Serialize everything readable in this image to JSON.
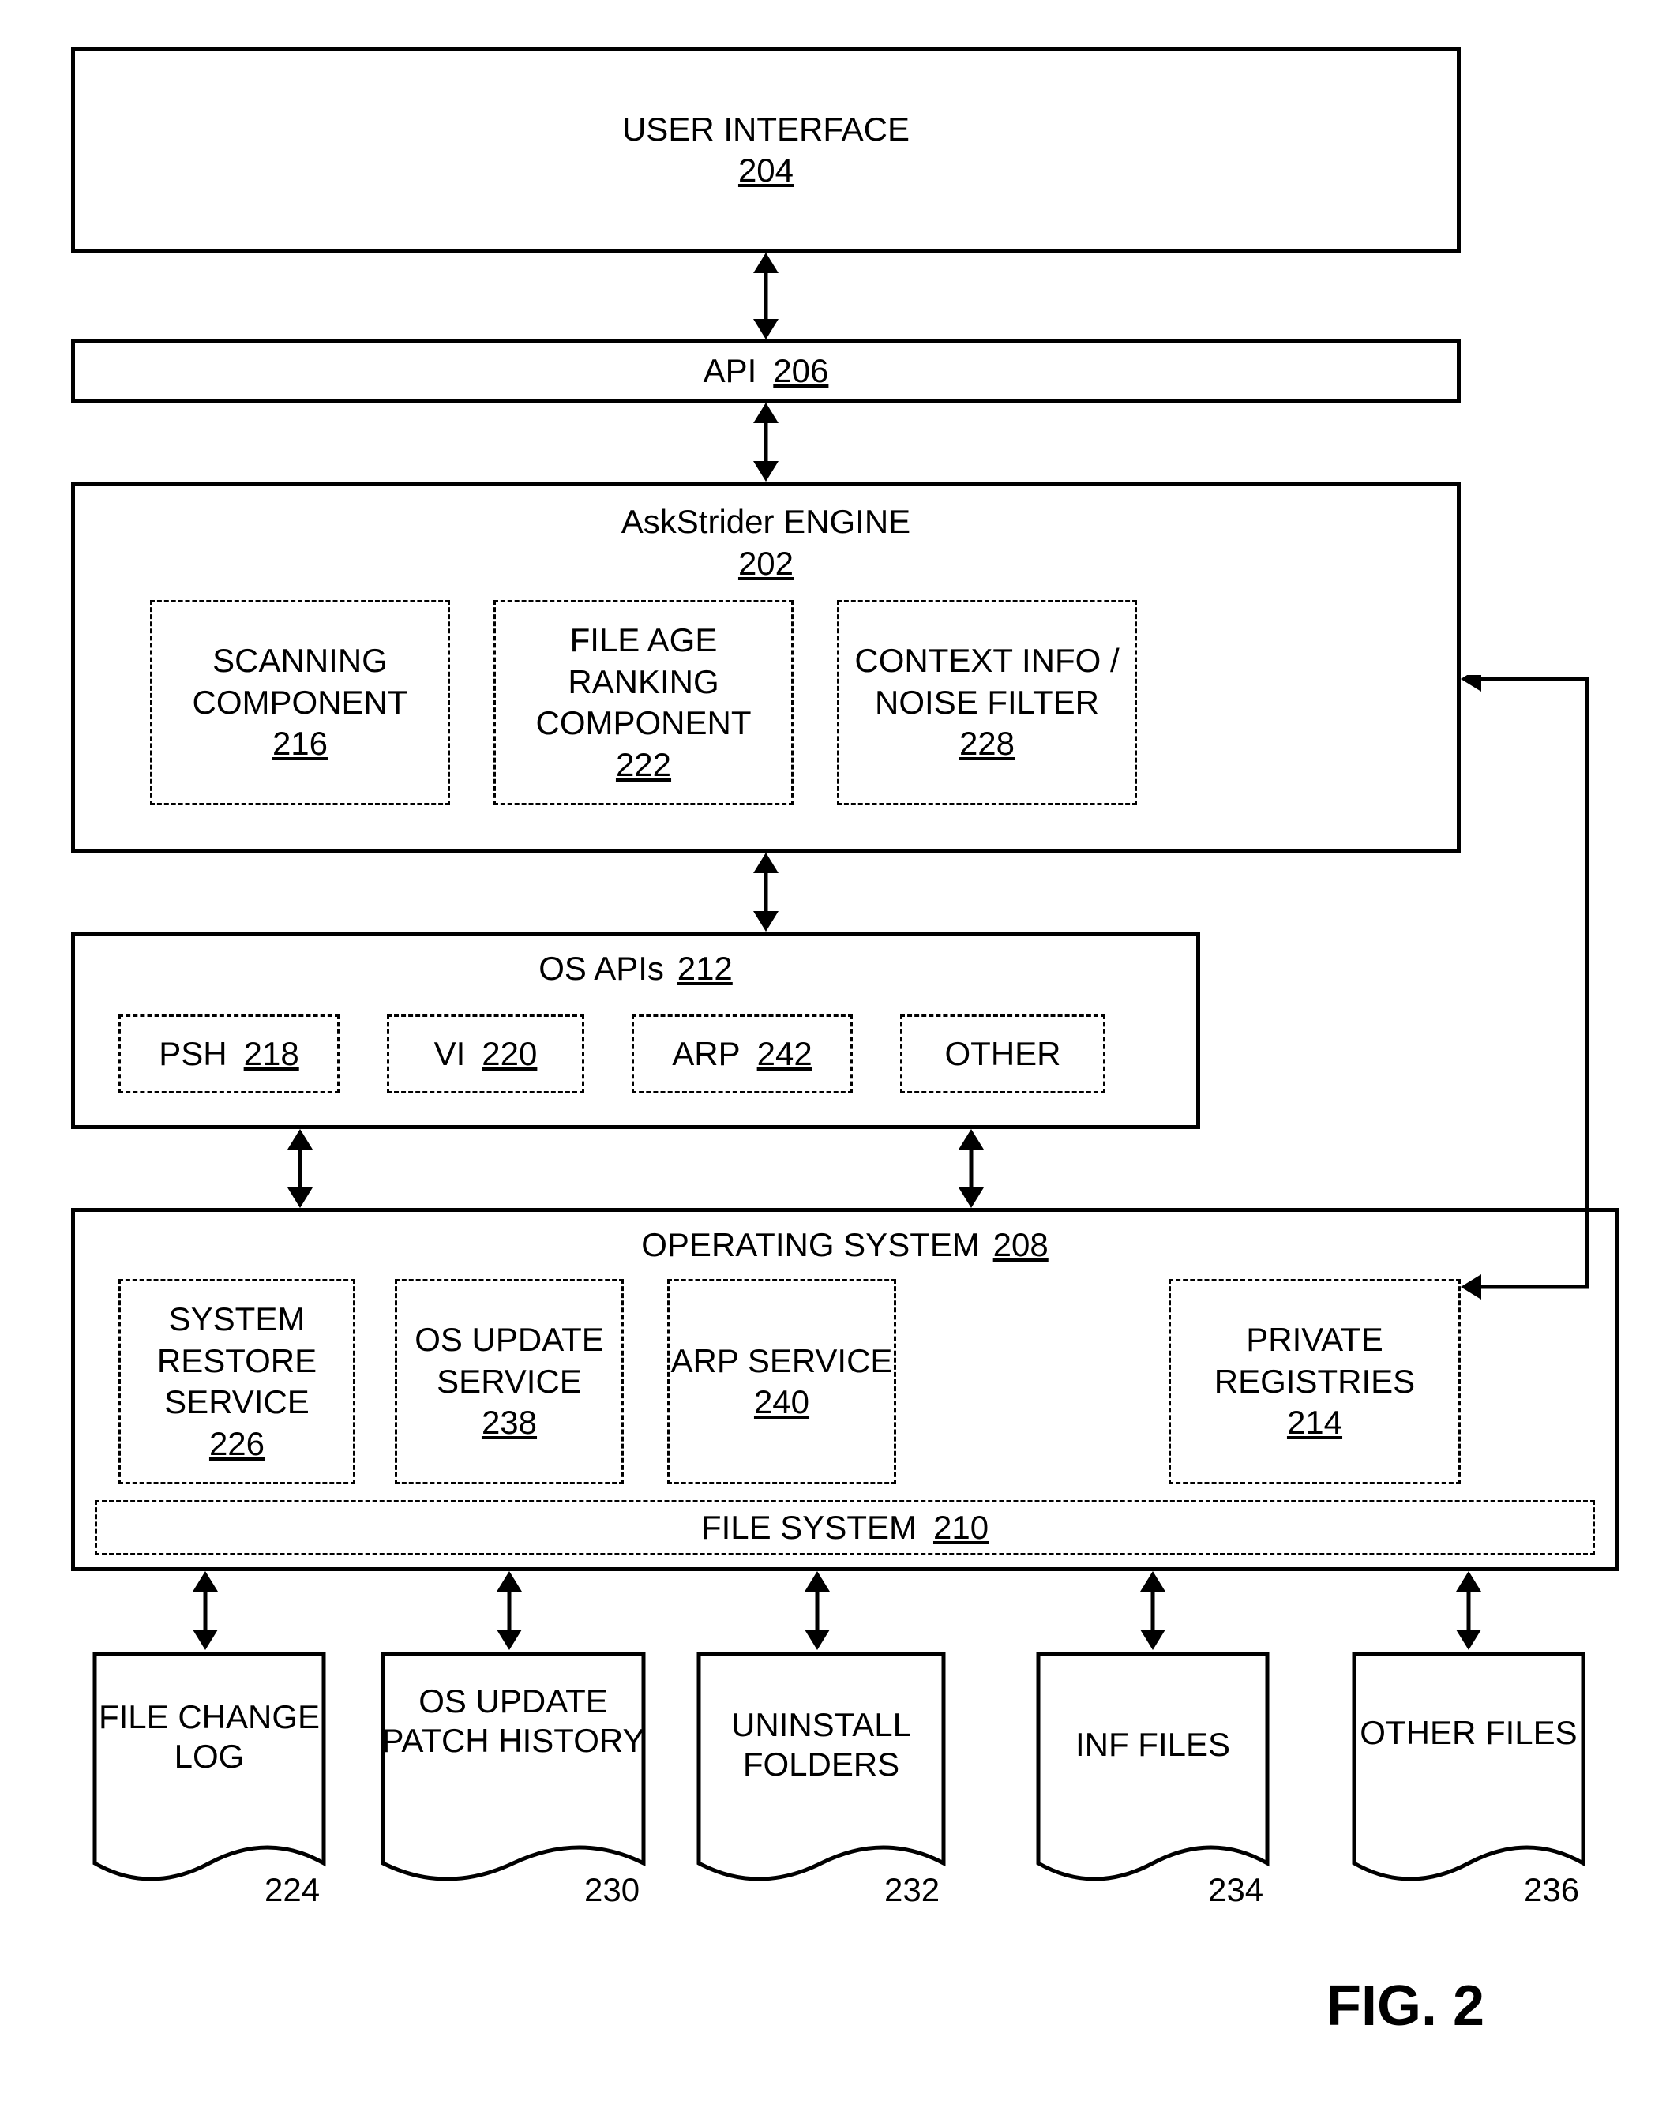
{
  "boxes": {
    "ui": {
      "label": "USER INTERFACE",
      "ref": "204"
    },
    "api": {
      "label": "API",
      "ref": "206"
    },
    "engine": {
      "label": "AskStrider ENGINE",
      "ref": "202"
    },
    "scanning": {
      "label": "SCANNING COMPONENT",
      "ref": "216"
    },
    "fileage": {
      "label": "FILE AGE RANKING COMPONENT",
      "ref": "222"
    },
    "context": {
      "label": "CONTEXT INFO / NOISE FILTER",
      "ref": "228"
    },
    "osapis": {
      "label": "OS APIs",
      "ref": "212"
    },
    "psh": {
      "label": "PSH",
      "ref": "218"
    },
    "vi": {
      "label": "VI",
      "ref": "220"
    },
    "arp": {
      "label": "ARP",
      "ref": "242"
    },
    "other_api": {
      "label": "OTHER"
    },
    "os": {
      "label": "OPERATING SYSTEM",
      "ref": "208"
    },
    "sysrestore": {
      "label": "SYSTEM RESTORE SERVICE",
      "ref": "226"
    },
    "osupdate": {
      "label": "OS UPDATE SERVICE",
      "ref": "238"
    },
    "arpservice": {
      "label": "ARP SERVICE",
      "ref": "240"
    },
    "privreg": {
      "label": "PRIVATE REGISTRIES",
      "ref": "214"
    },
    "filesystem": {
      "label": "FILE SYSTEM",
      "ref": "210"
    }
  },
  "docs": {
    "filechange": {
      "label": "FILE CHANGE LOG",
      "ref": "224"
    },
    "patchhist": {
      "label": "OS UPDATE PATCH HISTORY",
      "ref": "230"
    },
    "uninstall": {
      "label": "UNINSTALL FOLDERS",
      "ref": "232"
    },
    "inffiles": {
      "label": "INF FILES",
      "ref": "234"
    },
    "otherfiles": {
      "label": "OTHER FILES",
      "ref": "236"
    }
  },
  "figure_label": "FIG. 2"
}
